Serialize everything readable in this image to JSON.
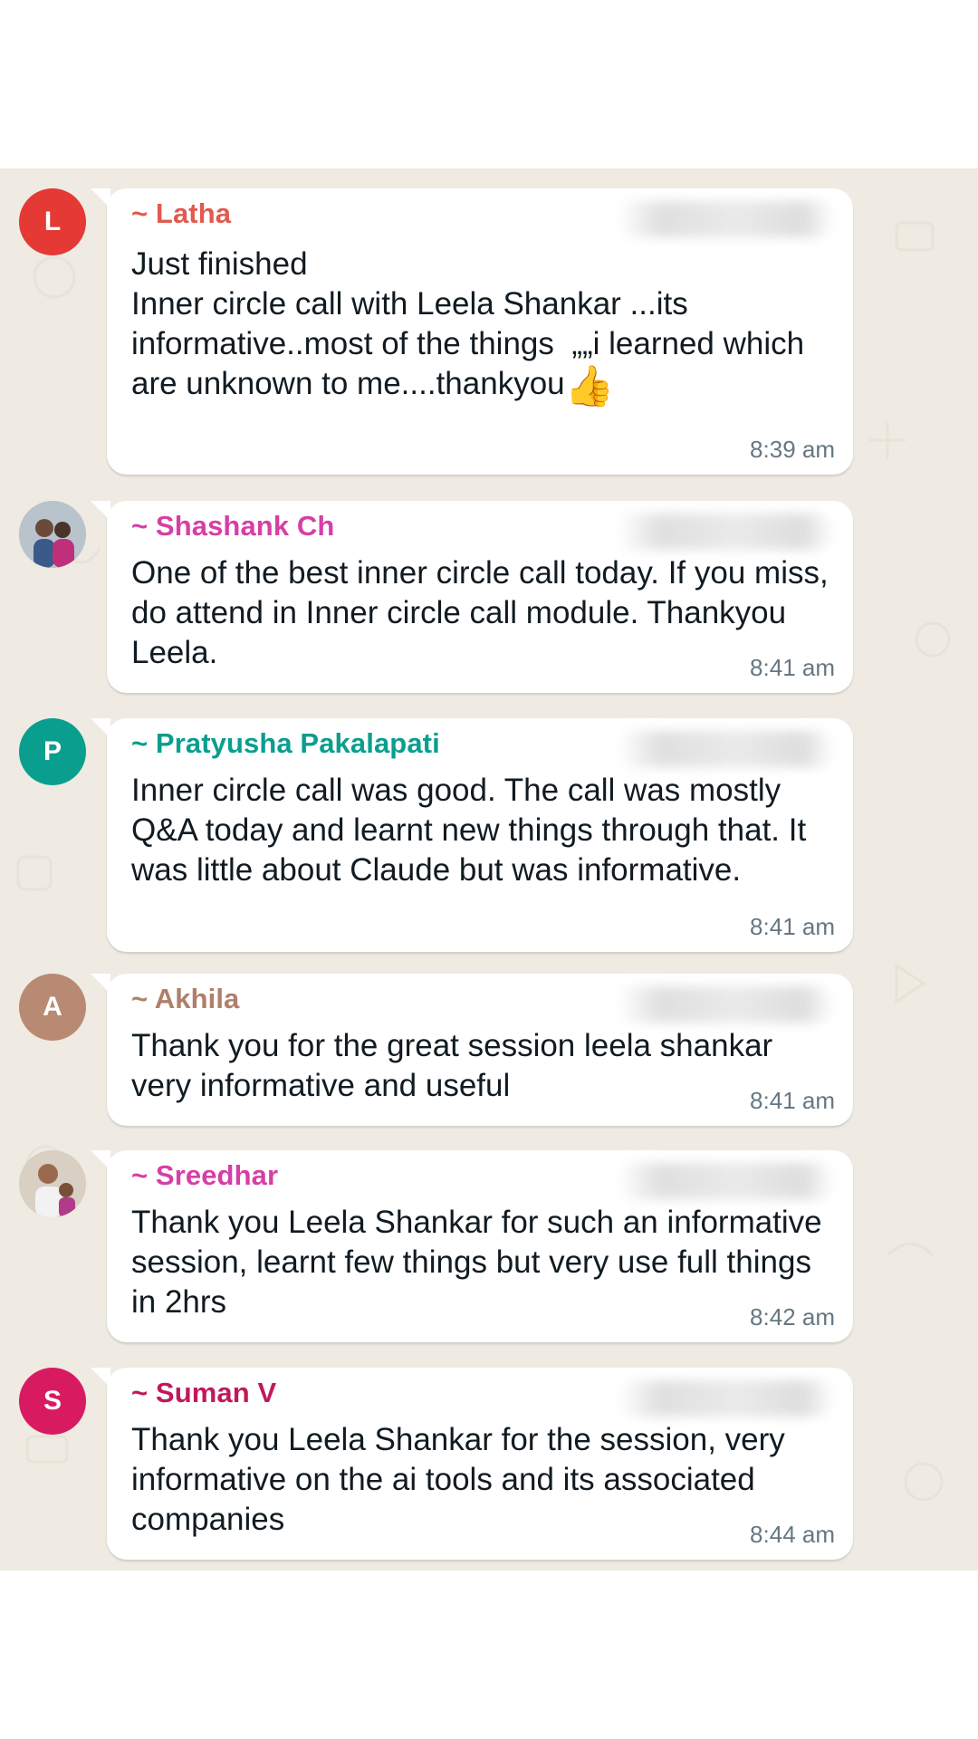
{
  "messages": [
    {
      "avatar_letter": "L",
      "avatar_color": "#e53935",
      "sender": "~ Latha",
      "sender_color": "#e05a4f",
      "text": "Just finished\nInner circle call with Leela Shankar ...its informative..most of the things  „„i learned which are unknown to me....thankyou",
      "emoji": "👍",
      "time": "8:39 am"
    },
    {
      "avatar_letter": "",
      "avatar_icon": "user-photo",
      "sender": "~ Shashank Ch",
      "sender_color": "#d63fa5",
      "text": "One of the best inner circle call today. If you miss, do attend in Inner circle call module. Thankyou Leela.",
      "time": "8:41 am"
    },
    {
      "avatar_letter": "P",
      "avatar_color": "#0a9e8e",
      "sender": "~ Pratyusha Pakalapati",
      "sender_color": "#0a9e8e",
      "text": "Inner circle call was good. The call was mostly Q&A today and learnt new things through that. It was little about Claude but was informative.",
      "time": "8:41 am"
    },
    {
      "avatar_letter": "A",
      "avatar_color": "#b98a73",
      "sender": "~ Akhila",
      "sender_color": "#b07f6a",
      "text": "Thank you for the great session leela shankar very informative and useful",
      "time": "8:41 am"
    },
    {
      "avatar_letter": "",
      "avatar_icon": "user-photo",
      "sender": "~ Sreedhar",
      "sender_color": "#d63fa5",
      "text": "Thank you Leela Shankar for such an informative session, learnt few things but very use full things in 2hrs",
      "time": "8:42 am"
    },
    {
      "avatar_letter": "S",
      "avatar_color": "#d81b60",
      "sender": "~ Suman V",
      "sender_color": "#c2185b",
      "text": "Thank you Leela Shankar for the session, very informative on the ai tools and its associated companies",
      "time": "8:44 am"
    }
  ]
}
